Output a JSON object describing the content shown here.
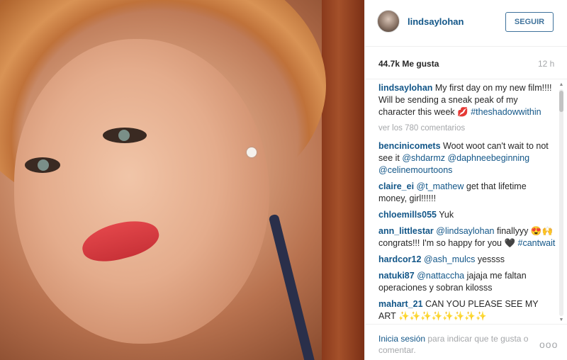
{
  "post": {
    "username": "lindsaylohan",
    "follow_label": "SEGUIR",
    "likes": "44.7k Me gusta",
    "time_ago": "12 h",
    "caption": {
      "user": "lindsaylohan",
      "text": "My first day on my new film!!!! Will be sending a sneak peak of my character this week 💋",
      "hashtag": "#theshadowwithin"
    },
    "view_all_comments": "ver los 780 comentarios",
    "comments": [
      {
        "user": "bencinicomets",
        "text": "Woot woot can't wait to not see it ",
        "mentions": [
          "@shdarmz",
          "@daphneebeginning",
          "@celinemourtoons"
        ]
      },
      {
        "user": "claire_ei",
        "mention": "@t_mathew",
        "text": " get that lifetime money, girl!!!!!!"
      },
      {
        "user": "chloemills055",
        "text": "Yuk"
      },
      {
        "user": "ann_littlestar",
        "mention": "@lindsaylohan",
        "text": " finallyyy 😍🙌 congrats!!! I'm so happy for you 🖤",
        "hashtag": "#cantwait"
      },
      {
        "user": "hardcor12",
        "mention": "@ash_mulcs",
        "text": " yessss"
      },
      {
        "user": "natuki87",
        "mention": "@nattaccha",
        "text": " jajaja me faltan operaciones y sobran kilosss"
      },
      {
        "user": "mahart_21",
        "text": "CAN YOU PLEASE SEE MY ART ✨✨✨✨✨✨✨✨"
      }
    ],
    "footer": {
      "login_link": "Inicia sesión",
      "login_text": " para indicar que te gusta o comentar.",
      "more_label": "ooo"
    }
  },
  "colors": {
    "link": "#125688",
    "follow_border": "#3f729b",
    "muted": "#a5a7aa"
  },
  "icons": {
    "avatar": "profile-avatar",
    "more": "more-options-icon",
    "scroll_up": "scroll-up-arrow",
    "scroll_down": "scroll-down-arrow"
  }
}
